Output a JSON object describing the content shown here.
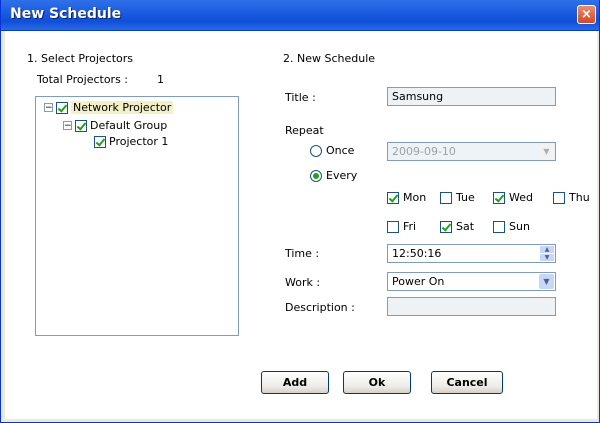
{
  "window": {
    "title": "New Schedule",
    "close_glyph": "×"
  },
  "left": {
    "section_label": "1. Select Projectors",
    "total_label": "Total Projectors :",
    "total_value": "1",
    "tree": [
      {
        "label": "Network Projector",
        "checked": true,
        "expanded": true
      },
      {
        "label": "Default Group",
        "checked": true,
        "expanded": true
      },
      {
        "label": "Projector 1",
        "checked": true
      }
    ]
  },
  "right": {
    "section_label": "2. New Schedule",
    "title_label": "Title :",
    "title_value": "Samsung",
    "repeat_label": "Repeat",
    "once_label": "Once",
    "once_date": "2009-09-10",
    "every_label": "Every",
    "repeat_mode": "every",
    "days": [
      {
        "label": "Mon",
        "checked": true
      },
      {
        "label": "Tue",
        "checked": false
      },
      {
        "label": "Wed",
        "checked": true
      },
      {
        "label": "Thu",
        "checked": false
      },
      {
        "label": "Fri",
        "checked": false
      },
      {
        "label": "Sat",
        "checked": true
      },
      {
        "label": "Sun",
        "checked": false
      }
    ],
    "time_label": "Time :",
    "time_value": "12:50:16",
    "work_label": "Work :",
    "work_value": "Power On",
    "description_label": "Description :",
    "description_value": ""
  },
  "buttons": {
    "add": "Add",
    "ok": "Ok",
    "cancel": "Cancel"
  }
}
